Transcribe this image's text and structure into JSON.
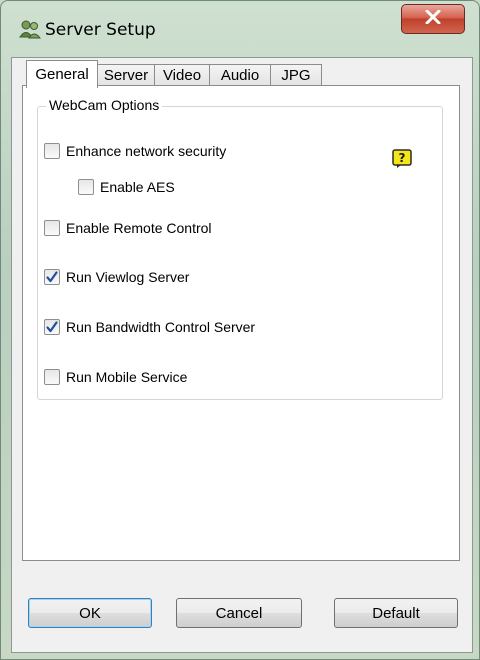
{
  "window": {
    "title": "Server Setup",
    "icon": "server-setup-icon",
    "close_icon": "close-icon"
  },
  "tabs": [
    {
      "label": "General",
      "active": true
    },
    {
      "label": "Server",
      "active": false
    },
    {
      "label": "Video",
      "active": false
    },
    {
      "label": "Audio",
      "active": false
    },
    {
      "label": "JPG",
      "active": false
    }
  ],
  "group": {
    "legend": "WebCam Options",
    "help_icon": "help-icon",
    "options": [
      {
        "label": "Enhance network security",
        "checked": false
      },
      {
        "label": "Enable AES",
        "checked": false
      },
      {
        "label": "Enable Remote Control",
        "checked": false
      },
      {
        "label": "Run Viewlog Server",
        "checked": true
      },
      {
        "label": "Run Bandwidth Control Server",
        "checked": true
      },
      {
        "label": "Run Mobile Service",
        "checked": false
      }
    ]
  },
  "buttons": {
    "ok": "OK",
    "cancel": "Cancel",
    "default": "Default"
  },
  "colors": {
    "checkmark": "#1f4f9e",
    "help_bg": "#f5e51b",
    "close_bg": "#c9503a"
  }
}
